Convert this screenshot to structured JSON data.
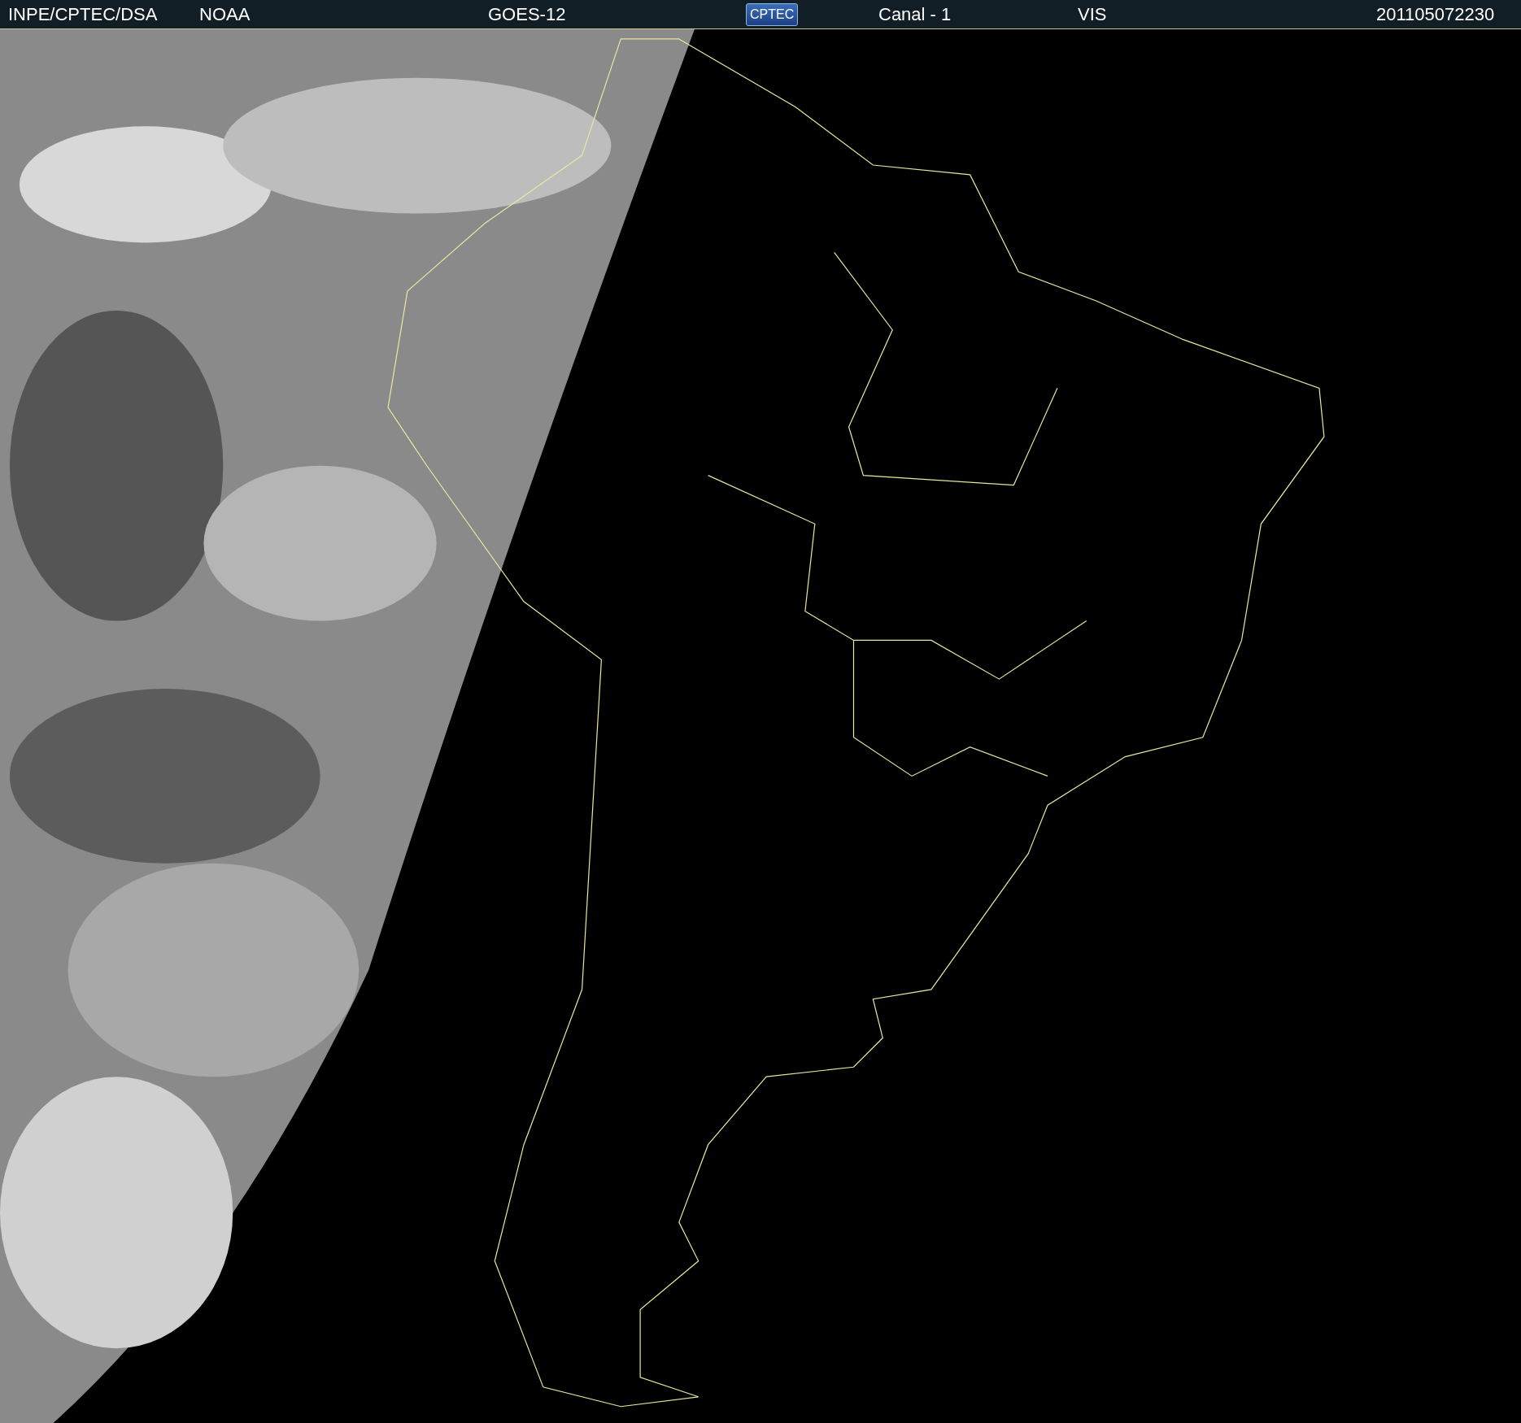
{
  "header": {
    "items": [
      {
        "kind": "text",
        "text": "INPE/CPTEC/DSA"
      },
      {
        "kind": "text",
        "text": "NOAA"
      },
      {
        "kind": "text",
        "text": "GOES-12"
      },
      {
        "kind": "logo",
        "text": "CPTEC"
      },
      {
        "kind": "text",
        "text": "Canal - 1"
      },
      {
        "kind": "text",
        "text": "VIS"
      },
      {
        "kind": "text",
        "text": "201105072230"
      }
    ]
  }
}
